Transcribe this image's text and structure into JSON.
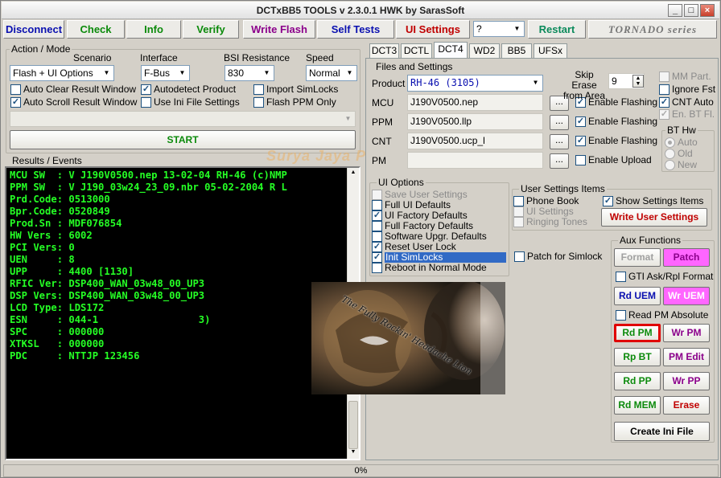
{
  "window": {
    "title": "DCTxBB5 TOOLS v 2.3.0.1 HWK by SarasSoft"
  },
  "toolbar": {
    "disconnect": "Disconnect",
    "check": "Check",
    "info": "Info",
    "verify": "Verify",
    "write_flash": "Write Flash",
    "self_tests": "Self Tests",
    "ui_settings": "UI Settings",
    "help_select": "?",
    "restart": "Restart",
    "brand": "TORNADO series"
  },
  "action_mode": {
    "title": "Action / Mode",
    "scenario_label": "Scenario",
    "scenario_value": "Flash + UI Options",
    "interface_label": "Interface",
    "interface_value": "F-Bus",
    "bsi_label": "BSI Resistance",
    "bsi_value": "830",
    "speed_label": "Speed",
    "speed_value": "Normal",
    "checks": [
      {
        "label": "Auto Clear Result Window",
        "checked": false
      },
      {
        "label": "Autodetect Product",
        "checked": true
      },
      {
        "label": "Import SimLocks",
        "checked": false
      },
      {
        "label": "Auto Scroll Result Window",
        "checked": true
      },
      {
        "label": "Use Ini File Settings",
        "checked": false
      },
      {
        "label": "Flash PPM Only",
        "checked": false
      }
    ],
    "start": "START"
  },
  "results": {
    "title": "Results / Events",
    "lines": [
      "MCU SW  : V J190V0500.nep 13-02-04 RH-46 (c)NMP",
      "PPM SW  : V J190_03w24_23_09.nbr 05-02-2004 R L",
      "Prd.Code: 0513000",
      "Bpr.Code: 0520849",
      "Prod.Sn : MDF076854",
      "HW Vers : 6002",
      "PCI Vers: 0",
      "UEN     : 8",
      "UPP     : 4400 [1130]",
      "RFIC Ver: DSP400_WAN_03w48_00_UP3",
      "DSP Vers: DSP400_WAN_03w48_00_UP3",
      "LCD Type: LDS172",
      "ESN     : 044-1                 3)",
      "SPC     : 000000",
      "XTKSL   : 000000",
      "PDC     : NTTJP 123456"
    ]
  },
  "watermark": "Surya Jaya Phones",
  "overlay_caption": "The Fully Rockin' Headache Lion",
  "tabs": [
    "DCT3",
    "DCTL",
    "DCT4",
    "WD2",
    "BB5",
    "UFSx"
  ],
  "files": {
    "title": "Files and Settings",
    "product_label": "Product",
    "product_value": "RH-46   (3105)",
    "rows": [
      {
        "label": "MCU",
        "value": "J190V0500.nep",
        "enable": "Enable Flashing",
        "checked": true
      },
      {
        "label": "PPM",
        "value": "J190V0500.llp",
        "enable": "Enable Flashing",
        "checked": true
      },
      {
        "label": "CNT",
        "value": "J190V0500.ucp_l",
        "enable": "Enable Flashing",
        "checked": true
      },
      {
        "label": "PM",
        "value": "",
        "enable": "Enable Upload",
        "checked": false
      }
    ],
    "browse": "...",
    "skip_erase_label": "Skip Erase from Area",
    "skip_erase_value": "9",
    "right_checks": [
      {
        "label": "MM Part.",
        "checked": false,
        "disabled": true
      },
      {
        "label": "Ignore Fst",
        "checked": false,
        "disabled": false
      },
      {
        "label": "CNT Auto",
        "checked": true,
        "disabled": false
      },
      {
        "label": "En. BT Fl.",
        "checked": true,
        "disabled": true
      }
    ],
    "bt_hw": {
      "title": "BT Hw",
      "options": [
        "Auto",
        "Old",
        "New"
      ],
      "selected": "Auto"
    }
  },
  "ui_options": {
    "title": "UI Options",
    "items": [
      {
        "label": "Save User Settings",
        "checked": false,
        "disabled": true
      },
      {
        "label": "Full UI Defaults",
        "checked": false,
        "disabled": false
      },
      {
        "label": "UI Factory Defaults",
        "checked": true,
        "disabled": false
      },
      {
        "label": "Full Factory Defaults",
        "checked": false,
        "disabled": false
      },
      {
        "label": "Software Upgr. Defaults",
        "checked": false,
        "disabled": false
      },
      {
        "label": "Reset User Lock",
        "checked": true,
        "disabled": false
      },
      {
        "label": "Init SimLocks",
        "checked": true,
        "disabled": false,
        "highlighted": true
      },
      {
        "label": "Reboot in Normal Mode",
        "checked": false,
        "disabled": false
      }
    ],
    "patch_simlock": "Patch for Simlock"
  },
  "user_settings": {
    "title": "User Settings Items",
    "items": [
      {
        "label": "Phone Book",
        "checked": false,
        "disabled": false
      },
      {
        "label": "UI Settings",
        "checked": false,
        "disabled": true
      },
      {
        "label": "Ringing Tones",
        "checked": false,
        "disabled": true
      }
    ],
    "show_items": "Show Settings Items",
    "write": "Write User Settings"
  },
  "aux": {
    "title": "Aux Functions",
    "format": "Format",
    "patch": "Patch",
    "gti": "GTI Ask/Rpl Format",
    "rd_uem": "Rd UEM",
    "wr_uem": "Wr UEM",
    "read_pm_abs": "Read PM Absolute",
    "rd_pm": "Rd PM",
    "wr_pm": "Wr PM",
    "rp_bt": "Rp BT",
    "pm_edit": "PM Edit",
    "rd_pp": "Rd PP",
    "wr_pp": "Wr PP",
    "rd_mem": "Rd MEM",
    "erase": "Erase",
    "create_ini": "Create Ini File"
  },
  "status": {
    "progress": "0%"
  },
  "colors": {
    "console_text": "#25ff25",
    "green": "#0b8a0b",
    "blue": "#0a10b0",
    "purple": "#8b008b",
    "red": "#c00000",
    "magenta_bg": "#ff66ff",
    "highlight": "#316ac5"
  }
}
